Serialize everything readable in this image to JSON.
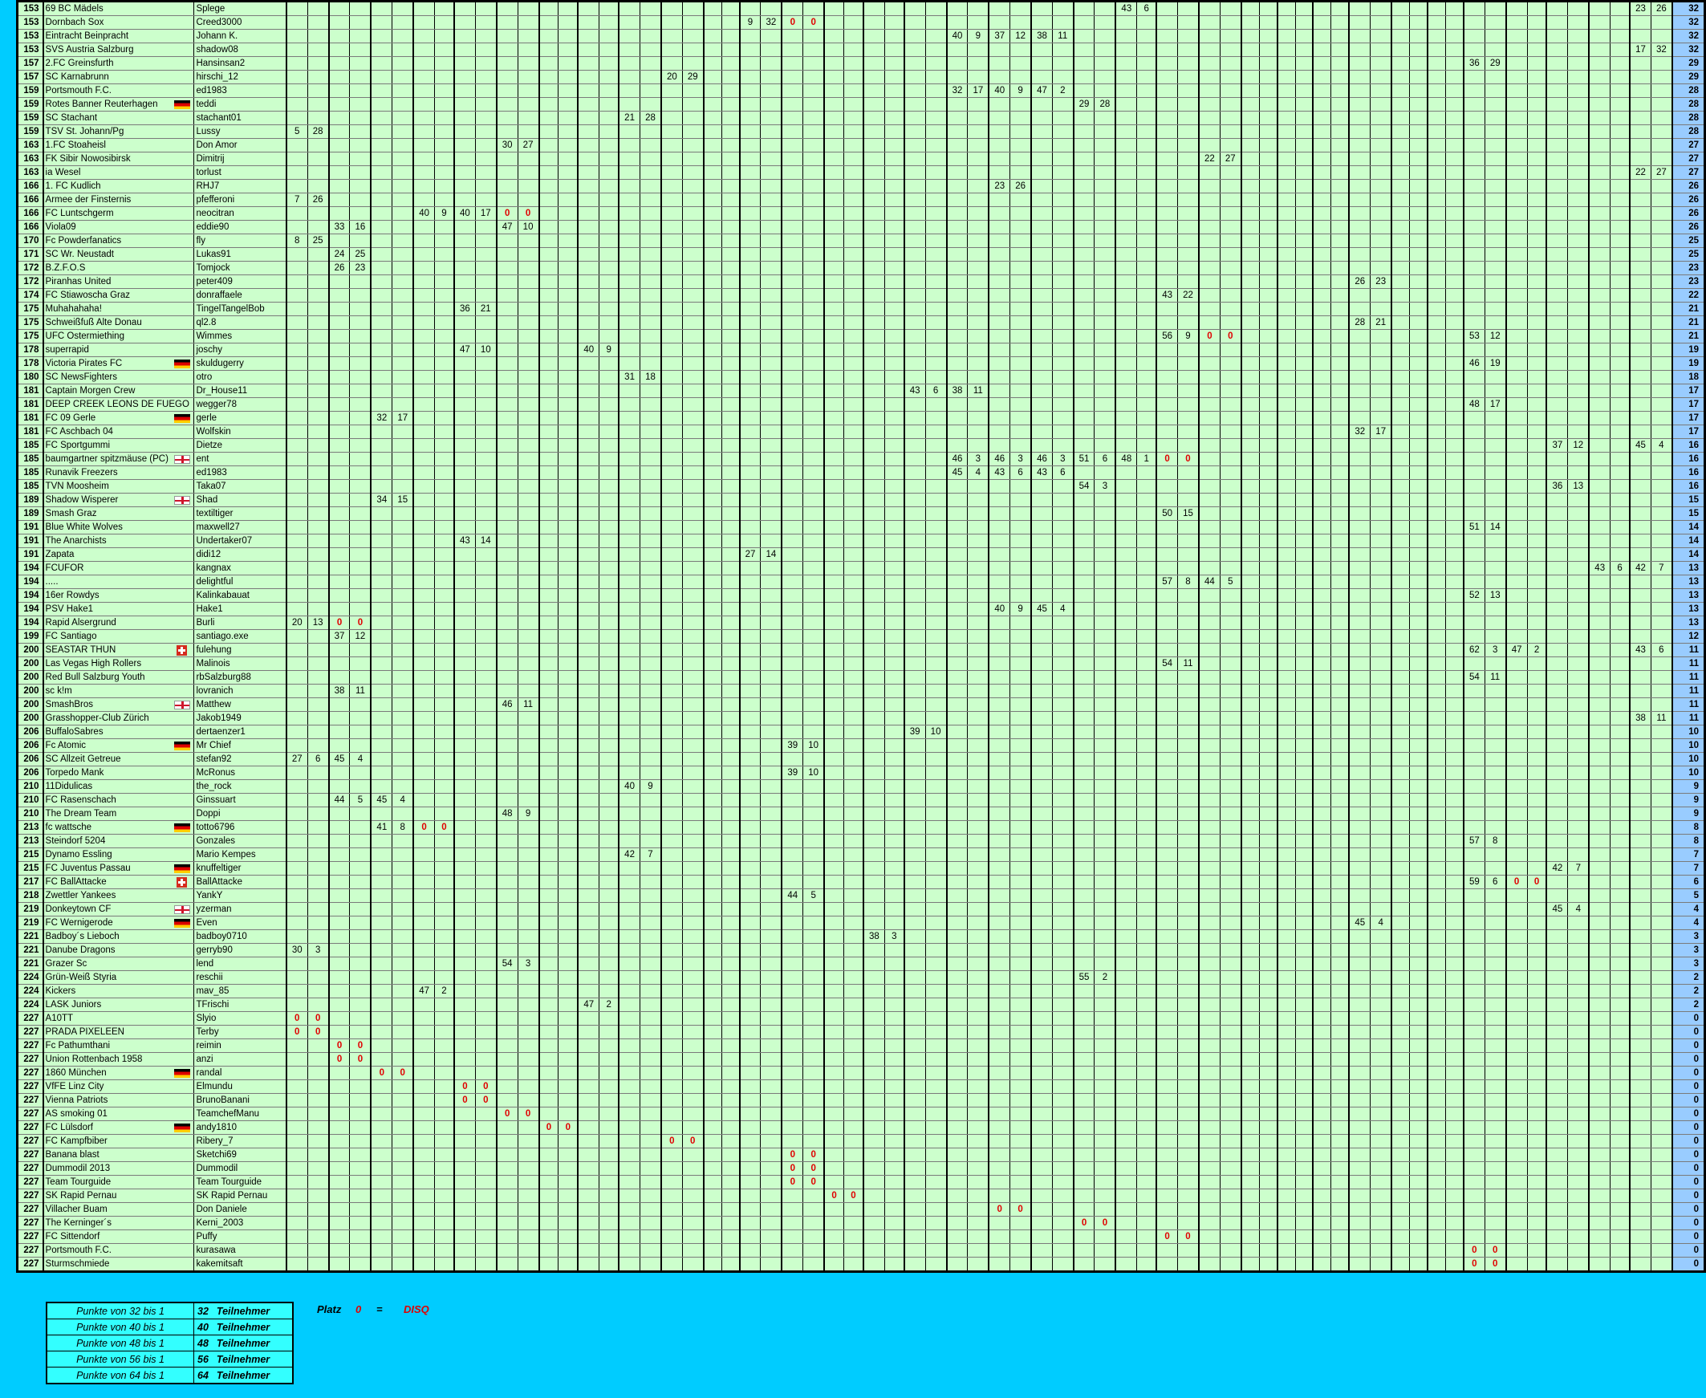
{
  "colors": {
    "background": "#00ccff",
    "grid": "#ccffcc",
    "total": "#99ccff",
    "zero": "#e00000",
    "legend": "#33ffff"
  },
  "rows": [
    {
      "rank": "153",
      "team": "69 BC Mädels",
      "flag": "",
      "user": "Splege",
      "vals": {
        "40": "43",
        "41": "6",
        "66": "23",
        "67": "26"
      },
      "total": "32"
    },
    {
      "rank": "153",
      "team": "Dornbach Sox",
      "flag": "",
      "user": "Creed3000",
      "vals": {
        "22": "9",
        "23": "32",
        "24": "0",
        "25": "0"
      },
      "total": "32"
    },
    {
      "rank": "153",
      "team": "Eintracht Beinpracht",
      "flag": "",
      "user": "Johann K.",
      "vals": {
        "32": "40",
        "33": "9",
        "34": "37",
        "35": "12",
        "36": "38",
        "37": "11"
      },
      "total": "32"
    },
    {
      "rank": "153",
      "team": "SVS Austria Salzburg",
      "flag": "",
      "user": "shadow08",
      "vals": {
        "66": "17",
        "67": "32"
      },
      "total": "32"
    },
    {
      "rank": "157",
      "team": "2.FC Greinsfurth",
      "flag": "",
      "user": "Hansinsan2",
      "vals": {
        "58": "36",
        "59": "29"
      },
      "total": "29"
    },
    {
      "rank": "157",
      "team": "SC Karnabrunn",
      "flag": "",
      "user": "hirschi_12",
      "vals": {
        "18": "20",
        "19": "29"
      },
      "total": "29"
    },
    {
      "rank": "159",
      "team": "Portsmouth F.C.",
      "flag": "",
      "user": "ed1983",
      "vals": {
        "32": "32",
        "33": "17",
        "34": "40",
        "35": "9",
        "36": "47",
        "37": "2"
      },
      "total": "28"
    },
    {
      "rank": "159",
      "team": "Rotes Banner Reuterhagen",
      "flag": "de",
      "user": "teddi",
      "vals": {
        "38": "29",
        "39": "28"
      },
      "total": "28"
    },
    {
      "rank": "159",
      "team": "SC Stachant",
      "flag": "",
      "user": "stachant01",
      "vals": {
        "16": "21",
        "17": "28"
      },
      "total": "28"
    },
    {
      "rank": "159",
      "team": "TSV St. Johann/Pg",
      "flag": "",
      "user": "Lussy",
      "vals": {
        "0": "5",
        "1": "28"
      },
      "total": "28"
    },
    {
      "rank": "163",
      "team": "1.FC Stoaheisl",
      "flag": "",
      "user": "Don Amor",
      "vals": {
        "10": "30",
        "11": "27"
      },
      "total": "27"
    },
    {
      "rank": "163",
      "team": "FK Sibir Nowosibirsk",
      "flag": "",
      "user": "Dimitrij",
      "vals": {
        "44": "22",
        "45": "27"
      },
      "total": "27"
    },
    {
      "rank": "163",
      "team": "ia Wesel",
      "flag": "",
      "user": "torlust",
      "vals": {
        "66": "22",
        "67": "27"
      },
      "total": "27"
    },
    {
      "rank": "166",
      "team": "1. FC Kudlich",
      "flag": "",
      "user": "RHJ7",
      "vals": {
        "34": "23",
        "35": "26"
      },
      "total": "26"
    },
    {
      "rank": "166",
      "team": "Armee der Finsternis",
      "flag": "",
      "user": "pfefferoni",
      "vals": {
        "0": "7",
        "1": "26"
      },
      "total": "26"
    },
    {
      "rank": "166",
      "team": "FC Luntschgerm",
      "flag": "",
      "user": "neocitran",
      "vals": {
        "6": "40",
        "7": "9",
        "8": "40",
        "9": "17",
        "10": "0",
        "11": "0"
      },
      "total": "26"
    },
    {
      "rank": "166",
      "team": "Viola09",
      "flag": "",
      "user": "eddie90",
      "vals": {
        "2": "33",
        "3": "16",
        "10": "47",
        "11": "10"
      },
      "total": "26"
    },
    {
      "rank": "170",
      "team": "Fc Powderfanatics",
      "flag": "",
      "user": "fly",
      "vals": {
        "0": "8",
        "1": "25"
      },
      "total": "25"
    },
    {
      "rank": "171",
      "team": "SC Wr. Neustadt",
      "flag": "",
      "user": "Lukas91",
      "vals": {
        "2": "24",
        "3": "25"
      },
      "total": "25"
    },
    {
      "rank": "172",
      "team": "B.Z.F.O.S",
      "flag": "",
      "user": "Tomjock",
      "vals": {
        "2": "26",
        "3": "23"
      },
      "total": "23"
    },
    {
      "rank": "172",
      "team": "Piranhas United",
      "flag": "",
      "user": "peter409",
      "vals": {
        "52": "26",
        "53": "23"
      },
      "total": "23"
    },
    {
      "rank": "174",
      "team": "FC Stiawoscha Graz",
      "flag": "",
      "user": "donraffaele",
      "vals": {
        "42": "43",
        "43": "22"
      },
      "total": "22"
    },
    {
      "rank": "175",
      "team": "Muhahahaha!",
      "flag": "",
      "user": "TingelTangelBob",
      "vals": {
        "8": "36",
        "9": "21"
      },
      "total": "21"
    },
    {
      "rank": "175",
      "team": "Schweißfuß Alte Donau",
      "flag": "",
      "user": "ql2.8",
      "vals": {
        "52": "28",
        "53": "21"
      },
      "total": "21"
    },
    {
      "rank": "175",
      "team": "UFC Ostermiething",
      "flag": "",
      "user": "Wimmes",
      "vals": {
        "42": "56",
        "43": "9",
        "44": "0",
        "45": "0",
        "58": "53",
        "59": "12"
      },
      "total": "21"
    },
    {
      "rank": "178",
      "team": "superrapid",
      "flag": "",
      "user": "joschy",
      "vals": {
        "8": "47",
        "9": "10",
        "14": "40",
        "15": "9"
      },
      "total": "19"
    },
    {
      "rank": "178",
      "team": "Victoria Pirates FC",
      "flag": "de",
      "user": "skuldugerry",
      "vals": {
        "58": "46",
        "59": "19"
      },
      "total": "19"
    },
    {
      "rank": "180",
      "team": "SC NewsFighters",
      "flag": "",
      "user": "otro",
      "vals": {
        "16": "31",
        "17": "18"
      },
      "total": "18"
    },
    {
      "rank": "181",
      "team": "Captain Morgen Crew",
      "flag": "",
      "user": "Dr_House11",
      "vals": {
        "30": "43",
        "31": "6",
        "32": "38",
        "33": "11"
      },
      "total": "17"
    },
    {
      "rank": "181",
      "team": "DEEP CREEK LEONS DE FUEGO",
      "flag": "",
      "user": "wegger78",
      "vals": {
        "58": "48",
        "59": "17"
      },
      "total": "17"
    },
    {
      "rank": "181",
      "team": "FC 09 Gerle",
      "flag": "de",
      "user": "gerle",
      "vals": {
        "4": "32",
        "5": "17"
      },
      "total": "17"
    },
    {
      "rank": "181",
      "team": "FC Aschbach 04",
      "flag": "",
      "user": "Wolfskin",
      "vals": {
        "52": "32",
        "53": "17"
      },
      "total": "17"
    },
    {
      "rank": "185",
      "team": "FC Sportgummi",
      "flag": "",
      "user": "Dietze",
      "vals": {
        "62": "37",
        "63": "12",
        "66": "45",
        "67": "4"
      },
      "total": "16"
    },
    {
      "rank": "185",
      "team": "baumgartner spitzmäuse (PC)",
      "flag": "en",
      "user": "ent",
      "vals": {
        "32": "46",
        "33": "3",
        "34": "46",
        "35": "3",
        "36": "46",
        "37": "3",
        "38": "51",
        "39": "6",
        "40": "48",
        "41": "1",
        "42": "0",
        "43": "0"
      },
      "total": "16"
    },
    {
      "rank": "185",
      "team": "Runavik Freezers",
      "flag": "",
      "user": "ed1983",
      "vals": {
        "32": "45",
        "33": "4",
        "34": "43",
        "35": "6",
        "36": "43",
        "37": "6"
      },
      "total": "16"
    },
    {
      "rank": "185",
      "team": "TVN Moosheim",
      "flag": "",
      "user": "Taka07",
      "vals": {
        "38": "54",
        "39": "3",
        "62": "36",
        "63": "13"
      },
      "total": "16"
    },
    {
      "rank": "189",
      "team": "Shadow Wisperer",
      "flag": "en",
      "user": "Shad",
      "vals": {
        "4": "34",
        "5": "15"
      },
      "total": "15"
    },
    {
      "rank": "189",
      "team": "Smash Graz",
      "flag": "",
      "user": "textiltiger",
      "vals": {
        "42": "50",
        "43": "15"
      },
      "total": "15"
    },
    {
      "rank": "191",
      "team": "Blue White Wolves",
      "flag": "",
      "user": "maxwell27",
      "vals": {
        "58": "51",
        "59": "14"
      },
      "total": "14"
    },
    {
      "rank": "191",
      "team": "The Anarchists",
      "flag": "",
      "user": "Undertaker07",
      "vals": {
        "8": "43",
        "9": "14"
      },
      "total": "14"
    },
    {
      "rank": "191",
      "team": "Zapata",
      "flag": "",
      "user": "didi12",
      "vals": {
        "22": "27",
        "23": "14"
      },
      "total": "14"
    },
    {
      "rank": "194",
      "team": "FCUFOR",
      "flag": "",
      "user": "kangnax",
      "vals": {
        "64": "43",
        "65": "6",
        "66": "42",
        "67": "7"
      },
      "total": "13"
    },
    {
      "rank": "194",
      "team": ".....",
      "flag": "",
      "user": "delightful",
      "vals": {
        "42": "57",
        "43": "8",
        "44": "44",
        "45": "5"
      },
      "total": "13"
    },
    {
      "rank": "194",
      "team": "16er Rowdys",
      "flag": "",
      "user": "Kalinkabauat",
      "vals": {
        "58": "52",
        "59": "13"
      },
      "total": "13"
    },
    {
      "rank": "194",
      "team": "PSV Hake1",
      "flag": "",
      "user": "Hake1",
      "vals": {
        "34": "40",
        "35": "9",
        "36": "45",
        "37": "4"
      },
      "total": "13"
    },
    {
      "rank": "194",
      "team": "Rapid Alsergrund",
      "flag": "",
      "user": "Burli",
      "vals": {
        "0": "20",
        "1": "13",
        "2": "0",
        "3": "0"
      },
      "total": "13"
    },
    {
      "rank": "199",
      "team": "FC Santiago",
      "flag": "",
      "user": "santiago.exe",
      "vals": {
        "2": "37",
        "3": "12"
      },
      "total": "12"
    },
    {
      "rank": "200",
      "team": "SEASTAR THUN",
      "flag": "ch",
      "user": "fulehung",
      "vals": {
        "58": "62",
        "59": "3",
        "60": "47",
        "61": "2",
        "66": "43",
        "67": "6"
      },
      "total": "11"
    },
    {
      "rank": "200",
      "team": "Las Vegas High Rollers",
      "flag": "",
      "user": "Malinois",
      "vals": {
        "42": "54",
        "43": "11"
      },
      "total": "11"
    },
    {
      "rank": "200",
      "team": "Red Bull Salzburg Youth",
      "flag": "",
      "user": "rbSalzburg88",
      "vals": {
        "58": "54",
        "59": "11"
      },
      "total": "11"
    },
    {
      "rank": "200",
      "team": "sc k!m",
      "flag": "",
      "user": "lovranich",
      "vals": {
        "2": "38",
        "3": "11"
      },
      "total": "11"
    },
    {
      "rank": "200",
      "team": "SmashBros",
      "flag": "en",
      "user": "Matthew",
      "vals": {
        "10": "46",
        "11": "11"
      },
      "total": "11"
    },
    {
      "rank": "200",
      "team": "Grasshopper-Club Zürich",
      "flag": "",
      "user": "Jakob1949",
      "vals": {
        "66": "38",
        "67": "11"
      },
      "total": "11"
    },
    {
      "rank": "206",
      "team": "BuffaloSabres",
      "flag": "",
      "user": "dertaenzer1",
      "vals": {
        "30": "39",
        "31": "10"
      },
      "total": "10"
    },
    {
      "rank": "206",
      "team": "Fc Atomic",
      "flag": "de",
      "user": "Mr Chief",
      "vals": {
        "24": "39",
        "25": "10"
      },
      "total": "10"
    },
    {
      "rank": "206",
      "team": "SC Allzeit Getreue",
      "flag": "",
      "user": "stefan92",
      "vals": {
        "0": "27",
        "1": "6",
        "2": "45",
        "3": "4"
      },
      "total": "10"
    },
    {
      "rank": "206",
      "team": "Torpedo Mank",
      "flag": "",
      "user": "McRonus",
      "vals": {
        "24": "39",
        "25": "10"
      },
      "total": "10"
    },
    {
      "rank": "210",
      "team": "11Didulicas",
      "flag": "",
      "user": "the_rock",
      "vals": {
        "16": "40",
        "17": "9"
      },
      "total": "9"
    },
    {
      "rank": "210",
      "team": "FC Rasenschach",
      "flag": "",
      "user": "Ginssuart",
      "vals": {
        "2": "44",
        "3": "5",
        "4": "45",
        "5": "4"
      },
      "total": "9"
    },
    {
      "rank": "210",
      "team": "The Dream Team",
      "flag": "",
      "user": "Doppi",
      "vals": {
        "10": "48",
        "11": "9"
      },
      "total": "9"
    },
    {
      "rank": "213",
      "team": "fc wattsche",
      "flag": "de",
      "user": "totto6796",
      "vals": {
        "4": "41",
        "5": "8",
        "6": "0",
        "7": "0"
      },
      "total": "8"
    },
    {
      "rank": "213",
      "team": "Steindorf 5204",
      "flag": "",
      "user": "Gonzales",
      "vals": {
        "58": "57",
        "59": "8"
      },
      "total": "8"
    },
    {
      "rank": "215",
      "team": "Dynamo Essling",
      "flag": "",
      "user": "Mario Kempes",
      "vals": {
        "16": "42",
        "17": "7"
      },
      "total": "7"
    },
    {
      "rank": "215",
      "team": "FC Juventus Passau",
      "flag": "de",
      "user": "knuffeltiger",
      "vals": {
        "62": "42",
        "63": "7"
      },
      "total": "7"
    },
    {
      "rank": "217",
      "team": "FC BallAttacke",
      "flag": "ch",
      "user": "BallAttacke",
      "vals": {
        "58": "59",
        "59": "6",
        "60": "0",
        "61": "0"
      },
      "total": "6"
    },
    {
      "rank": "218",
      "team": "Zwettler Yankees",
      "flag": "",
      "user": "YankY",
      "vals": {
        "24": "44",
        "25": "5"
      },
      "total": "5"
    },
    {
      "rank": "219",
      "team": "Donkeytown CF",
      "flag": "en",
      "user": "yzerman",
      "vals": {
        "62": "45",
        "63": "4"
      },
      "total": "4"
    },
    {
      "rank": "219",
      "team": "FC Wernigerode",
      "flag": "de",
      "user": "Even",
      "vals": {
        "52": "45",
        "53": "4"
      },
      "total": "4"
    },
    {
      "rank": "221",
      "team": "Badboy´s Lieboch",
      "flag": "",
      "user": "badboy0710",
      "vals": {
        "28": "38",
        "29": "3"
      },
      "total": "3"
    },
    {
      "rank": "221",
      "team": "Danube Dragons",
      "flag": "",
      "user": "gerryb90",
      "vals": {
        "0": "30",
        "1": "3"
      },
      "total": "3"
    },
    {
      "rank": "221",
      "team": "Grazer Sc",
      "flag": "",
      "user": "lend",
      "vals": {
        "10": "54",
        "11": "3"
      },
      "total": "3"
    },
    {
      "rank": "224",
      "team": "Grün-Weiß Styria",
      "flag": "",
      "user": "reschii",
      "vals": {
        "38": "55",
        "39": "2"
      },
      "total": "2"
    },
    {
      "rank": "224",
      "team": "Kickers",
      "flag": "",
      "user": "mav_85",
      "vals": {
        "6": "47",
        "7": "2"
      },
      "total": "2"
    },
    {
      "rank": "224",
      "team": "LASK Juniors",
      "flag": "",
      "user": "TFrischi",
      "vals": {
        "14": "47",
        "15": "2"
      },
      "total": "2"
    },
    {
      "rank": "227",
      "team": "A10TT",
      "flag": "",
      "user": "Slyio",
      "vals": {
        "0": "0",
        "1": "0"
      },
      "total": "0"
    },
    {
      "rank": "227",
      "team": "PRADA PIXELEEN",
      "flag": "",
      "user": "Terby",
      "vals": {
        "0": "0",
        "1": "0"
      },
      "total": "0"
    },
    {
      "rank": "227",
      "team": "Fc Pathumthani",
      "flag": "",
      "user": "reimin",
      "vals": {
        "2": "0",
        "3": "0"
      },
      "total": "0"
    },
    {
      "rank": "227",
      "team": "Union Rottenbach 1958",
      "flag": "",
      "user": "anzi",
      "vals": {
        "2": "0",
        "3": "0"
      },
      "total": "0"
    },
    {
      "rank": "227",
      "team": "1860 München",
      "flag": "de",
      "user": "randal",
      "vals": {
        "4": "0",
        "5": "0"
      },
      "total": "0"
    },
    {
      "rank": "227",
      "team": "VfFE Linz City",
      "flag": "",
      "user": "Elmundu",
      "vals": {
        "8": "0",
        "9": "0"
      },
      "total": "0"
    },
    {
      "rank": "227",
      "team": "Vienna Patriots",
      "flag": "",
      "user": "BrunoBanani",
      "vals": {
        "8": "0",
        "9": "0"
      },
      "total": "0"
    },
    {
      "rank": "227",
      "team": "AS smoking 01",
      "flag": "",
      "user": "TeamchefManu",
      "vals": {
        "10": "0",
        "11": "0"
      },
      "total": "0"
    },
    {
      "rank": "227",
      "team": "FC Lülsdorf",
      "flag": "de",
      "user": "andy1810",
      "vals": {
        "12": "0",
        "13": "0"
      },
      "total": "0"
    },
    {
      "rank": "227",
      "team": "FC Kampfbiber",
      "flag": "",
      "user": "Ribery_7",
      "vals": {
        "18": "0",
        "19": "0"
      },
      "total": "0"
    },
    {
      "rank": "227",
      "team": "Banana blast",
      "flag": "",
      "user": "Sketchi69",
      "vals": {
        "24": "0",
        "25": "0"
      },
      "total": "0"
    },
    {
      "rank": "227",
      "team": "Dummodil 2013",
      "flag": "",
      "user": "Dummodil",
      "vals": {
        "24": "0",
        "25": "0"
      },
      "total": "0"
    },
    {
      "rank": "227",
      "team": "Team Tourguide",
      "flag": "",
      "user": "Team Tourguide",
      "vals": {
        "24": "0",
        "25": "0"
      },
      "total": "0"
    },
    {
      "rank": "227",
      "team": "SK Rapid Pernau",
      "flag": "",
      "user": "SK Rapid Pernau",
      "vals": {
        "26": "0",
        "27": "0"
      },
      "total": "0"
    },
    {
      "rank": "227",
      "team": "Villacher Buam",
      "flag": "",
      "user": "Don Daniele",
      "vals": {
        "34": "0",
        "35": "0"
      },
      "total": "0"
    },
    {
      "rank": "227",
      "team": "The Kerninger´s",
      "flag": "",
      "user": "Kerni_2003",
      "vals": {
        "38": "0",
        "39": "0"
      },
      "total": "0"
    },
    {
      "rank": "227",
      "team": "FC Sittendorf",
      "flag": "",
      "user": "Puffy",
      "vals": {
        "42": "0",
        "43": "0"
      },
      "total": "0"
    },
    {
      "rank": "227",
      "team": "Portsmouth F.C.",
      "flag": "",
      "user": "kurasawa",
      "vals": {
        "58": "0",
        "59": "0"
      },
      "total": "0"
    },
    {
      "rank": "227",
      "team": "Sturmschmiede",
      "flag": "",
      "user": "kakemitsaft",
      "vals": {
        "58": "0",
        "59": "0"
      },
      "total": "0"
    }
  ],
  "legend": [
    {
      "left": "Punkte von 32 bis 1",
      "num": "32",
      "word": "Teilnehmer"
    },
    {
      "left": "Punkte von 40 bis 1",
      "num": "40",
      "word": "Teilnehmer"
    },
    {
      "left": "Punkte von 48 bis 1",
      "num": "48",
      "word": "Teilnehmer"
    },
    {
      "left": "Punkte von 56 bis 1",
      "num": "56",
      "word": "Teilnehmer"
    },
    {
      "left": "Punkte von 64 bis 1",
      "num": "64",
      "word": "Teilnehmer"
    }
  ],
  "disq": {
    "platz": "Platz",
    "zero": "0",
    "eq": "=",
    "label": "DISQ"
  }
}
